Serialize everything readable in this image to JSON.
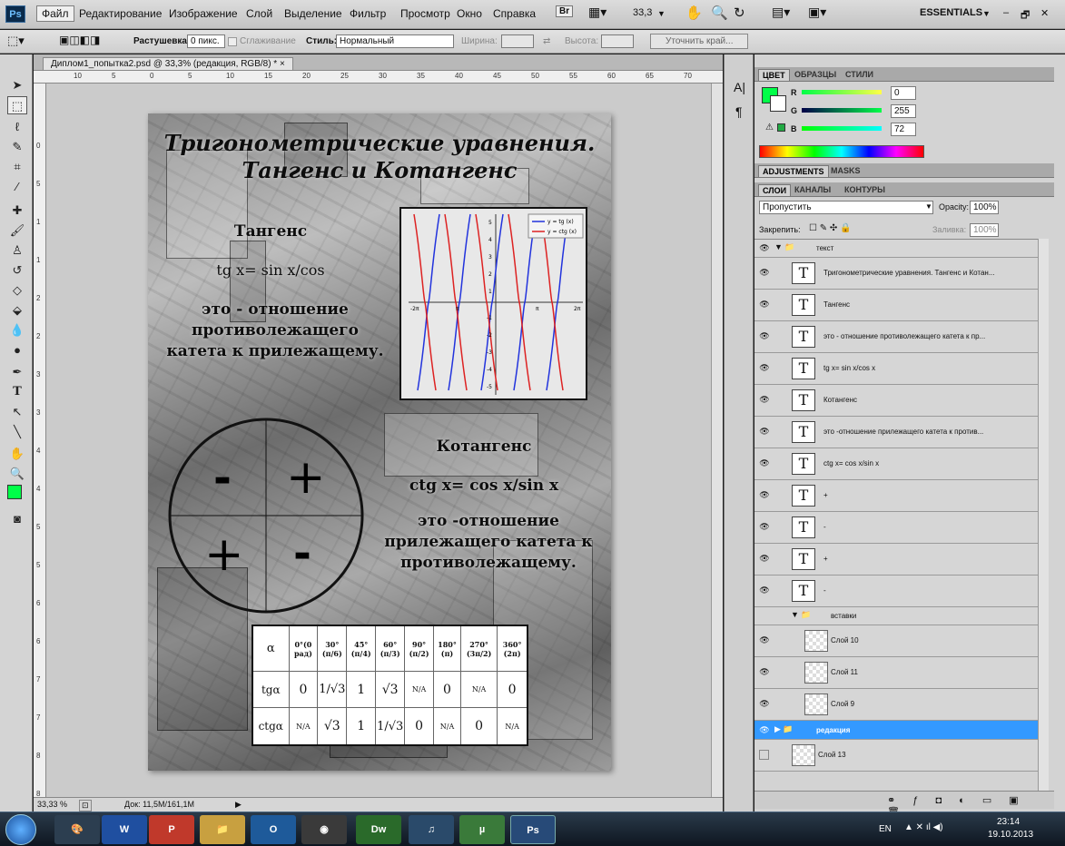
{
  "menubar": {
    "logo": "Ps",
    "items": [
      "Файл",
      "Редактирование",
      "Изображение",
      "Слой",
      "Выделение",
      "Фильтр",
      "Просмотр",
      "Окно",
      "Справка"
    ],
    "br_label": "Br",
    "zoom": "33,3",
    "workspace": "ESSENTIALS"
  },
  "options": {
    "feather_label": "Растушевка:",
    "feather_value": "0 пикс.",
    "antialias_label": "Сглаживание",
    "style_label": "Стиль:",
    "style_value": "Нормальный",
    "width_label": "Ширина:",
    "height_label": "Высота:",
    "refine_label": "Уточнить край..."
  },
  "document": {
    "tab_title": "Диплом1_попытка2.psd @ 33,3% (редакция, RGB/8) *",
    "close": "×",
    "ruler_h_ticks": [
      "10",
      "5",
      "0",
      "5",
      "10",
      "15",
      "20",
      "25",
      "30",
      "35",
      "40",
      "45",
      "50",
      "55",
      "60",
      "65",
      "70"
    ],
    "ruler_v_ticks": [
      "0",
      "5",
      "1",
      "1",
      "2",
      "2",
      "3",
      "3",
      "4",
      "4",
      "5",
      "5",
      "6",
      "6",
      "7",
      "7",
      "8",
      "8"
    ],
    "status_zoom": "33,33 %",
    "status_doc": "Док: 11,5М/161,1М"
  },
  "poster": {
    "title_line1": "Тригонометрические уравнения.",
    "title_line2": "Тангенс и Котангенс",
    "tan_heading": "Тангенс",
    "tan_formula": "tg x= sin x/cos",
    "tan_def1": "это - отношение",
    "tan_def2": "противолежащего",
    "tan_def3": "катета к прилежащему.",
    "cot_heading": "Котангенс",
    "cot_formula": "ctg x= cos x/sin x",
    "cot_def1": "это -отношение",
    "cot_def2": "прилежащего катета к",
    "cot_def3": "противолежащему.",
    "circle_signs": [
      "-",
      "+",
      "+",
      "-"
    ],
    "graph_legend": [
      "y = tg (x)",
      "y = ctg (x)"
    ],
    "graph_ticks_x": [
      "-2π",
      "π",
      "π",
      "2π"
    ],
    "graph_ticks_y": [
      "5",
      "4",
      "3",
      "2",
      "1",
      "-1",
      "-2",
      "-3",
      "-4",
      "-5"
    ],
    "table": {
      "header": [
        "α",
        "0°(0 рад)",
        "30° (π/6)",
        "45° (π/4)",
        "60° (π/3)",
        "90° (π/2)",
        "180° (π)",
        "270° (3π/2)",
        "360° (2π)"
      ],
      "rows": [
        [
          "tgα",
          "0",
          "1/√3",
          "1",
          "√3",
          "N/A",
          "0",
          "N/A",
          "0"
        ],
        [
          "ctgα",
          "N/A",
          "√3",
          "1",
          "1/√3",
          "0",
          "N/A",
          "0",
          "N/A"
        ]
      ]
    }
  },
  "color_panel": {
    "tabs": [
      "ЦВЕТ",
      "ОБРАЗЦЫ",
      "СТИЛИ"
    ],
    "r_label": "R",
    "r_value": "0",
    "g_label": "G",
    "g_value": "255",
    "b_label": "B",
    "b_value": "72",
    "foreground": "#00ff48"
  },
  "adjust_panel": {
    "tabs": [
      "ADJUSTMENTS",
      "MASKS"
    ]
  },
  "layers_panel": {
    "tabs": [
      "СЛОИ",
      "КАНАЛЫ",
      "КОНТУРЫ"
    ],
    "blend_mode": "Пропустить",
    "opacity_label": "Opacity:",
    "opacity_value": "100%",
    "lock_label": "Закрепить:",
    "fill_label": "Заливка:",
    "fill_value": "100%",
    "group_text": "текст",
    "text_layers": [
      "Тригонометрические уравнения. Тангенс и Котан...",
      "Тангенс",
      "это - отношение противолежащего катета к пр...",
      "tg x= sin x/cos x",
      "Котангенс",
      " это -отношение прилежащего катета к против...",
      "ctg x= cos x/sin x",
      "+",
      "-",
      "+",
      "-"
    ],
    "group_inserts": "вставки",
    "image_layers": [
      "Слой 10",
      "Слой 11",
      "Слой 9"
    ],
    "group_selected": "редакция",
    "layer_13": "Слой 13"
  },
  "taskbar": {
    "lang": "EN",
    "time": "23:14",
    "date": "19.10.2013",
    "apps": [
      "Dw",
      "Ps"
    ]
  }
}
